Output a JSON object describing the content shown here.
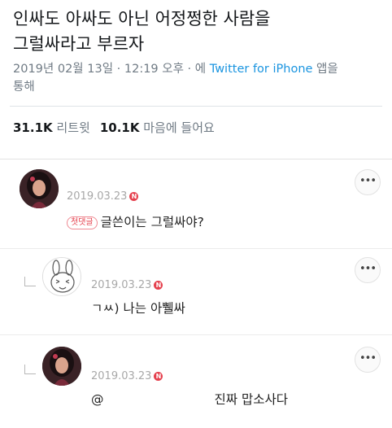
{
  "tweet": {
    "text_line1": "인싸도 아싸도 아닌 어정쩡한 사람을",
    "text_line2": "그럴싸라고 부르자",
    "date": "2019년 02월 13일 · 12:19 오후 · 에 ",
    "client": "Twitter for iPhone",
    "client_suffix": " 앱을",
    "meta_line2": "통해",
    "retweets_count": "31.1K",
    "retweets_label": "리트윗",
    "likes_count": "10.1K",
    "likes_label": "마음에 들어요"
  },
  "comments": [
    {
      "date": "2019.03.23",
      "new_badge": "N",
      "first_badge": "첫댓글",
      "text": "글쓴이는 그럴싸야?",
      "more_label": "•••"
    },
    {
      "date": "2019.03.23",
      "new_badge": "N",
      "text": "ㄱㅆ) 나는 아쀌싸",
      "more_label": "•••"
    },
    {
      "date": "2019.03.23",
      "new_badge": "N",
      "mention": "@",
      "text": "진짜 맙소사다",
      "more_label": "•••"
    }
  ],
  "colors": {
    "link": "#1b95e0",
    "meta": "#6f7a84",
    "badge_red": "#e5404d"
  }
}
